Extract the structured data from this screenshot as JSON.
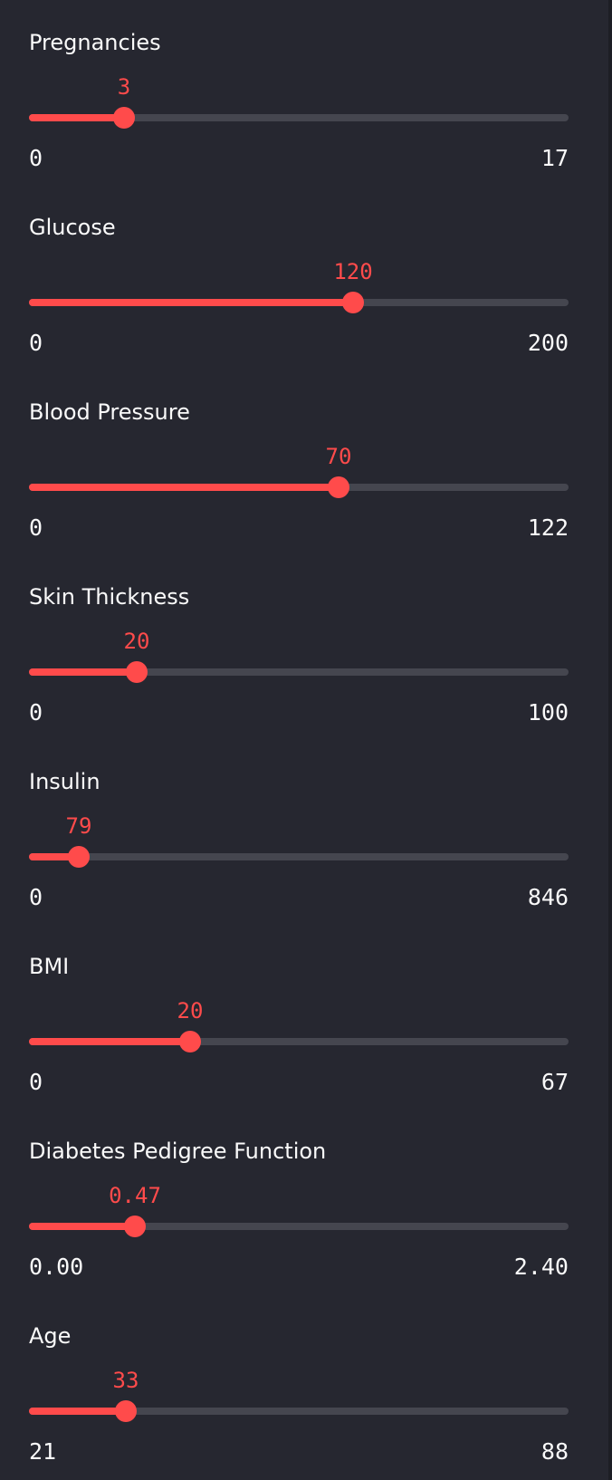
{
  "sliders": [
    {
      "name": "pregnancies",
      "label": "Pregnancies",
      "value": "3",
      "min": "0",
      "max": "17",
      "fraction": 0.176
    },
    {
      "name": "glucose",
      "label": "Glucose",
      "value": "120",
      "min": "0",
      "max": "200",
      "fraction": 0.6
    },
    {
      "name": "blood-pressure",
      "label": "Blood Pressure",
      "value": "70",
      "min": "0",
      "max": "122",
      "fraction": 0.574
    },
    {
      "name": "skin-thickness",
      "label": "Skin Thickness",
      "value": "20",
      "min": "0",
      "max": "100",
      "fraction": 0.2
    },
    {
      "name": "insulin",
      "label": "Insulin",
      "value": "79",
      "min": "0",
      "max": "846",
      "fraction": 0.093
    },
    {
      "name": "bmi",
      "label": "BMI",
      "value": "20",
      "min": "0",
      "max": "67",
      "fraction": 0.299
    },
    {
      "name": "diabetes-pedigree-function",
      "label": "Diabetes Pedigree Function",
      "value": "0.47",
      "min": "0.00",
      "max": "2.40",
      "fraction": 0.196
    },
    {
      "name": "age",
      "label": "Age",
      "value": "33",
      "min": "21",
      "max": "88",
      "fraction": 0.179
    }
  ],
  "colors": {
    "background": "#262730",
    "accent": "#ff4b4b",
    "track": "#45464f",
    "text": "#fafafa"
  }
}
